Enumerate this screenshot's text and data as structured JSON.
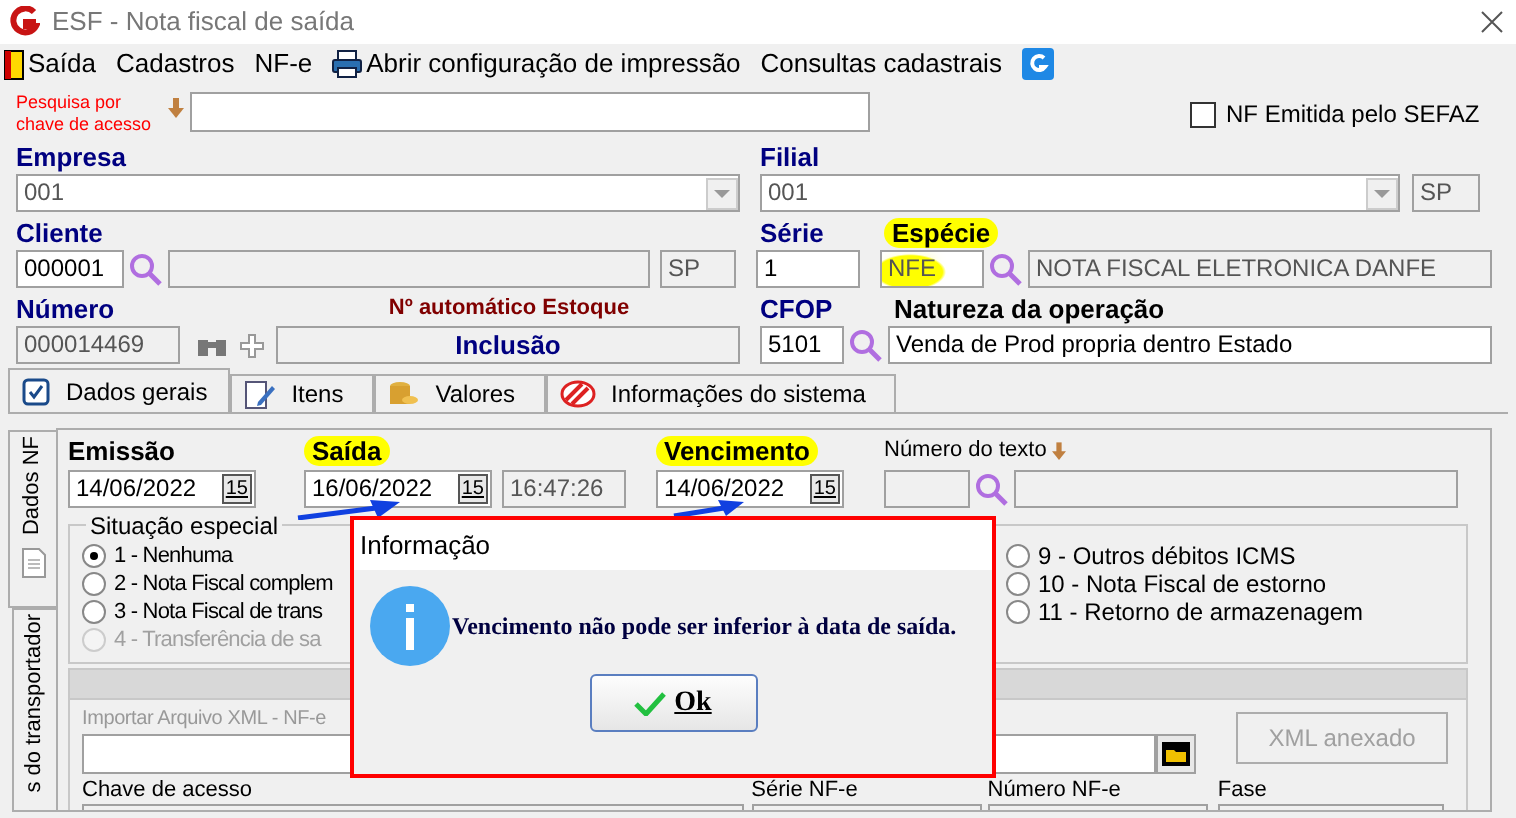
{
  "window": {
    "title": "ESF - Nota fiscal de saída"
  },
  "menu": [
    {
      "label": "Saída"
    },
    {
      "label": "Cadastros"
    },
    {
      "label": "NF-e"
    },
    {
      "label": "Abrir configuração de impressão"
    },
    {
      "label": "Consultas cadastrais"
    }
  ],
  "search": {
    "label": "Pesquisa por chave de acesso"
  },
  "sefaz": {
    "label": "NF Emitida pelo SEFAZ",
    "checked": false
  },
  "empresa": {
    "label": "Empresa",
    "value": "001"
  },
  "filial": {
    "label": "Filial",
    "value": "001",
    "uf": "SP"
  },
  "cliente": {
    "label": "Cliente",
    "code": "000001",
    "uf": "SP"
  },
  "serie": {
    "label": "Série",
    "value": "1"
  },
  "especie": {
    "label": "Espécie",
    "value": "NFE",
    "highlighted": true,
    "description": "NOTA FISCAL ELETRONICA DANFE"
  },
  "numero": {
    "label": "Número",
    "value": "000014469"
  },
  "auto_estoque": {
    "label": "Nº automático Estoque",
    "value": "Inclusão"
  },
  "cfop": {
    "label": "CFOP",
    "value": "5101"
  },
  "natureza": {
    "label": "Natureza da operação",
    "value": "Venda de Prod propria dentro Estado"
  },
  "tabs": [
    {
      "label": "Dados gerais",
      "selected": true
    },
    {
      "label": "Itens",
      "selected": false
    },
    {
      "label": "Valores",
      "selected": false
    },
    {
      "label": "Informações do sistema",
      "selected": false
    }
  ],
  "side_tabs": [
    {
      "label": "Dados NF",
      "selected": true
    },
    {
      "label": "s do transportador",
      "selected": false
    }
  ],
  "dates": [
    {
      "label": "Emissão",
      "value": "14/06/2022",
      "picker": "15",
      "highlighted": false
    },
    {
      "label": "Saída",
      "value": "16/06/2022",
      "picker": "15",
      "time": "16:47:26",
      "highlighted": true
    },
    {
      "label": "Vencimento",
      "value": "14/06/2022",
      "picker": "15",
      "highlighted": true
    }
  ],
  "numero_texto": {
    "label": "Número do texto"
  },
  "situacao": {
    "title": "Situação especial",
    "options": [
      {
        "label": "1 - Nenhuma",
        "selected": true,
        "disabled": false
      },
      {
        "label": "2 - Nota Fiscal complem",
        "selected": false,
        "disabled": false
      },
      {
        "label": "3 - Nota Fiscal de trans",
        "selected": false,
        "disabled": false
      },
      {
        "label": "4 - Transferência de sa",
        "selected": false,
        "disabled": true
      },
      {
        "label": "9 - Outros débitos ICMS",
        "selected": false,
        "disabled": false
      },
      {
        "label": "10 - Nota Fiscal de estorno",
        "selected": false,
        "disabled": false
      },
      {
        "label": "11 - Retorno de armazenagem",
        "selected": false,
        "disabled": false
      }
    ]
  },
  "xml": {
    "label": "Importar Arquivo XML - NF-e",
    "button": "XML anexado",
    "disabled": true
  },
  "lower_fields": [
    {
      "label": "Chave de acesso"
    },
    {
      "label": "Série NF-e"
    },
    {
      "label": "Número NF-e"
    },
    {
      "label": "Fase"
    }
  ],
  "dialog": {
    "title": "Informação",
    "message": "Vencimento não pode ser inferior à data de saída.",
    "button": "Ok"
  }
}
